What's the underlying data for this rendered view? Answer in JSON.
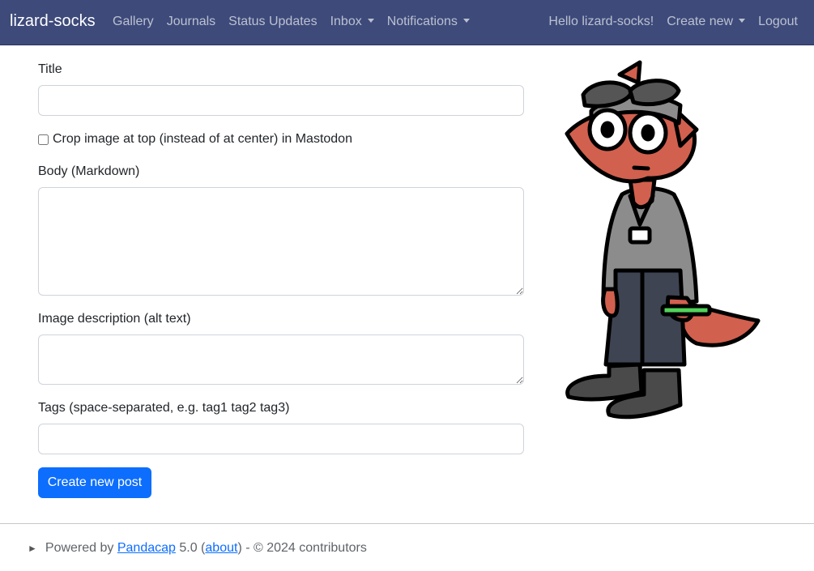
{
  "navbar": {
    "brand": "lizard-socks",
    "links": [
      "Gallery",
      "Journals",
      "Status Updates"
    ],
    "inbox": "Inbox",
    "notifications": "Notifications",
    "greeting": "Hello lizard-socks!",
    "create_new": "Create new",
    "logout": "Logout"
  },
  "form": {
    "title_label": "Title",
    "title_value": "",
    "crop_label": "Crop image at top (instead of at center) in Mastodon",
    "crop_checked": false,
    "body_label": "Body (Markdown)",
    "body_value": "",
    "alt_label": "Image description (alt text)",
    "alt_value": "",
    "tags_label": "Tags (space-separated, e.g. tag1 tag2 tag3)",
    "tags_value": "",
    "submit_label": "Create new post"
  },
  "footer": {
    "prefix": "Powered by",
    "pandacap_link": "Pandacap",
    "version": "5.0",
    "about_link": "about",
    "suffix": "- © 2024 contributors"
  },
  "colors": {
    "navbar_bg": "#3d4a7a",
    "primary": "#0d6efd",
    "character_skin": "#d2604e"
  }
}
